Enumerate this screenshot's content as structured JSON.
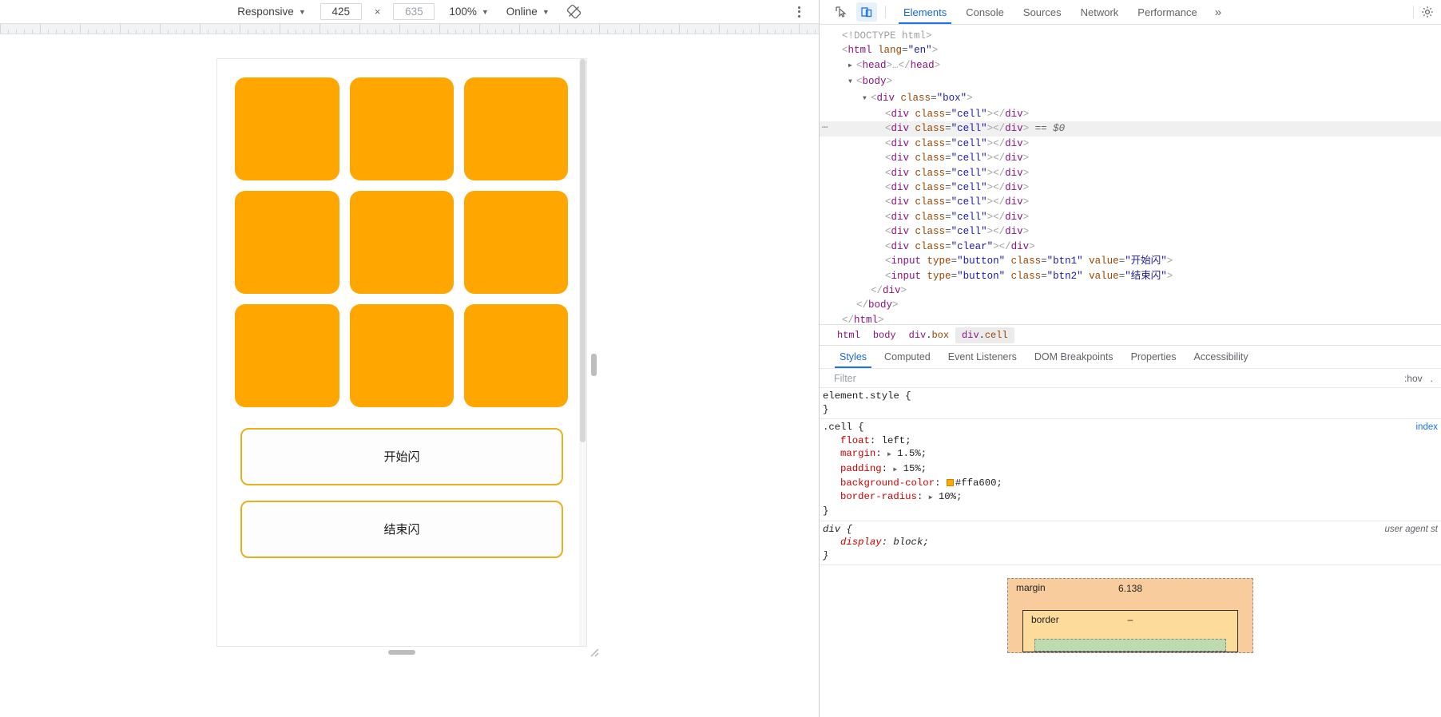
{
  "device_toolbar": {
    "device_select": "Responsive",
    "width": "425",
    "height": "635",
    "times": "×",
    "zoom": "100%",
    "throttle": "Online",
    "rotate_icon": "rotate-device-icon",
    "more_icon": "more-options-icon"
  },
  "page": {
    "cells": [
      "cell",
      "cell",
      "cell",
      "cell",
      "cell",
      "cell",
      "cell",
      "cell",
      "cell"
    ],
    "buttons": [
      {
        "label": "开始闪",
        "class": "btn1"
      },
      {
        "label": "结束闪",
        "class": "btn2"
      }
    ],
    "cell_color": "#ffa600"
  },
  "devtools": {
    "icons": {
      "inspect": "inspect-element-icon",
      "device": "toggle-device-toolbar-icon",
      "settings": "settings-gear-icon"
    },
    "tabs": [
      {
        "label": "Elements",
        "active": true
      },
      {
        "label": "Console",
        "active": false
      },
      {
        "label": "Sources",
        "active": false
      },
      {
        "label": "Network",
        "active": false
      },
      {
        "label": "Performance",
        "active": false
      }
    ],
    "more_tabs": "»",
    "dom": [
      {
        "indent": 0,
        "tri": "",
        "text": "<!DOCTYPE html>",
        "kind": "doctype"
      },
      {
        "indent": 0,
        "tri": "",
        "text": "<html lang=\"en\">",
        "kind": "html-open"
      },
      {
        "indent": 1,
        "tri": "▶",
        "text": "<head>…</head>",
        "kind": "head"
      },
      {
        "indent": 1,
        "tri": "▼",
        "text": "<body>",
        "kind": "body-open"
      },
      {
        "indent": 2,
        "tri": "▼",
        "text": "<div class=\"box\">",
        "kind": "div-box"
      },
      {
        "indent": 3,
        "tri": "",
        "text": "<div class=\"cell\"></div>",
        "kind": "cell"
      },
      {
        "indent": 3,
        "tri": "",
        "text": "<div class=\"cell\"></div>",
        "kind": "cell",
        "selected": true,
        "suffix": "== $0"
      },
      {
        "indent": 3,
        "tri": "",
        "text": "<div class=\"cell\"></div>",
        "kind": "cell"
      },
      {
        "indent": 3,
        "tri": "",
        "text": "<div class=\"cell\"></div>",
        "kind": "cell"
      },
      {
        "indent": 3,
        "tri": "",
        "text": "<div class=\"cell\"></div>",
        "kind": "cell"
      },
      {
        "indent": 3,
        "tri": "",
        "text": "<div class=\"cell\"></div>",
        "kind": "cell"
      },
      {
        "indent": 3,
        "tri": "",
        "text": "<div class=\"cell\"></div>",
        "kind": "cell"
      },
      {
        "indent": 3,
        "tri": "",
        "text": "<div class=\"cell\"></div>",
        "kind": "cell"
      },
      {
        "indent": 3,
        "tri": "",
        "text": "<div class=\"cell\"></div>",
        "kind": "cell"
      },
      {
        "indent": 3,
        "tri": "",
        "text": "<div class=\"clear\"></div>",
        "kind": "clear"
      },
      {
        "indent": 3,
        "tri": "",
        "text": "<input type=\"button\" class=\"btn1\" value=\"开始闪\">",
        "kind": "input1"
      },
      {
        "indent": 3,
        "tri": "",
        "text": "<input type=\"button\" class=\"btn2\" value=\"结束闪\">",
        "kind": "input2"
      },
      {
        "indent": 2,
        "tri": "",
        "text": "</div>",
        "kind": "close"
      },
      {
        "indent": 1,
        "tri": "",
        "text": "</body>",
        "kind": "close"
      },
      {
        "indent": 0,
        "tri": "",
        "text": "</html>",
        "kind": "close"
      }
    ],
    "breadcrumb": [
      {
        "label": "html",
        "active": false
      },
      {
        "label": "body",
        "active": false
      },
      {
        "label": "div.box",
        "active": false
      },
      {
        "label": "div.cell",
        "active": true
      }
    ],
    "style_tabs": [
      {
        "label": "Styles",
        "active": true
      },
      {
        "label": "Computed",
        "active": false
      },
      {
        "label": "Event Listeners",
        "active": false
      },
      {
        "label": "DOM Breakpoints",
        "active": false
      },
      {
        "label": "Properties",
        "active": false
      },
      {
        "label": "Accessibility",
        "active": false
      }
    ],
    "filter_placeholder": "Filter",
    "filter_value": "",
    "hov_label": ":hov",
    "rules": [
      {
        "selector": "element.style {",
        "close": "}",
        "source": "",
        "declarations": []
      },
      {
        "selector": ".cell {",
        "close": "}",
        "source": "index",
        "declarations": [
          {
            "prop": "float",
            "value": "left",
            "expandable": false
          },
          {
            "prop": "margin",
            "value": "1.5%",
            "expandable": true
          },
          {
            "prop": "padding",
            "value": "15%",
            "expandable": true
          },
          {
            "prop": "background-color",
            "value": "#ffa600",
            "expandable": false,
            "swatch": "#ffa600"
          },
          {
            "prop": "border-radius",
            "value": "10%",
            "expandable": true
          }
        ]
      },
      {
        "selector": "div {",
        "close": "}",
        "source": "user agent st",
        "user_agent": true,
        "declarations": [
          {
            "prop": "display",
            "value": "block",
            "expandable": false
          }
        ]
      }
    ],
    "box_model": {
      "margin_label": "margin",
      "margin_value": "6.138",
      "border_label": "border",
      "border_value": "–"
    }
  }
}
